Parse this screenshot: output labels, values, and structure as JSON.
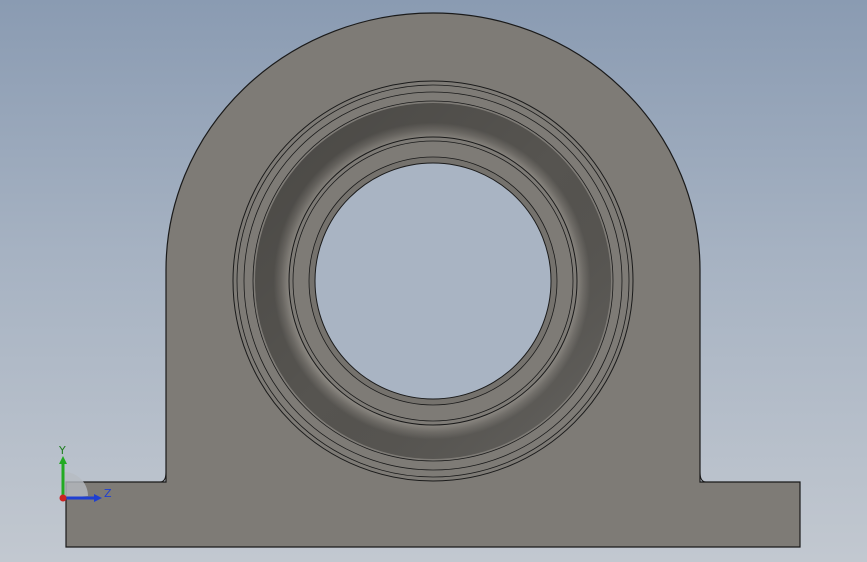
{
  "viewport": {
    "background_top": "#8a9bb2",
    "background_bottom": "#c2c8d0"
  },
  "model": {
    "part_color": "#7e7b76",
    "edge_color": "#1a1a1a"
  },
  "triad": {
    "y_label": "Y",
    "z_label": "Z",
    "y_color": "#22aa22",
    "z_color": "#1f3fd1",
    "x_color": "#cc2222"
  }
}
